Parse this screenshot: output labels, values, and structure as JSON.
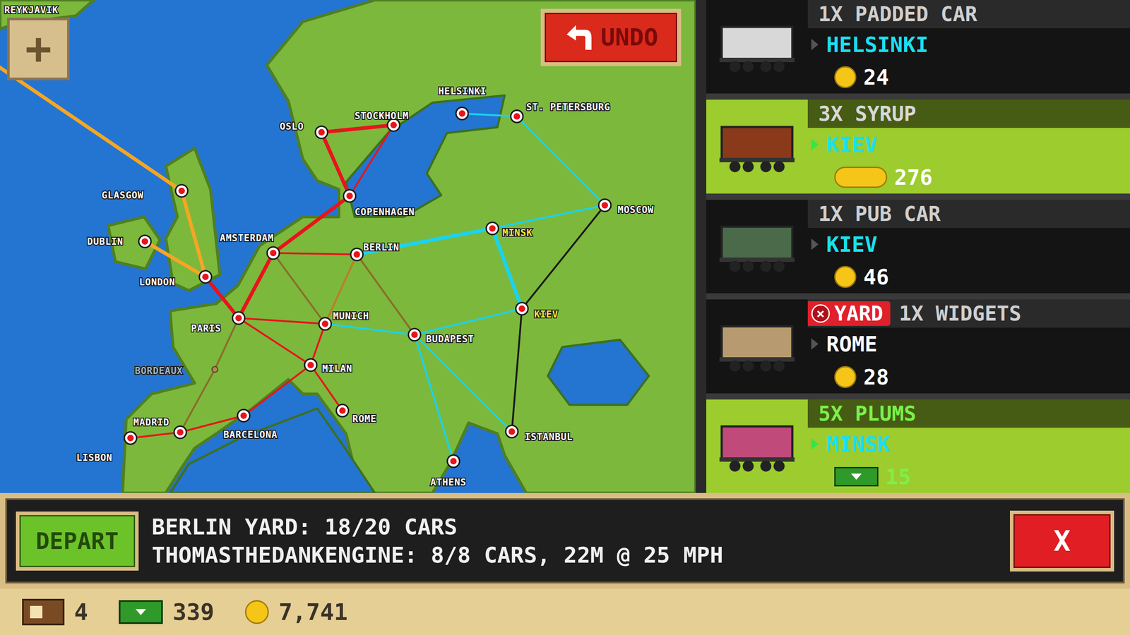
{
  "map": {
    "zoom_button": "+",
    "undo_button": "UNDO",
    "cities": [
      {
        "name": "REYKJAVIK",
        "state": "normal"
      },
      {
        "name": "GLASGOW",
        "state": "normal"
      },
      {
        "name": "DUBLIN",
        "state": "normal"
      },
      {
        "name": "LONDON",
        "state": "normal"
      },
      {
        "name": "PARIS",
        "state": "normal"
      },
      {
        "name": "BORDEAUX",
        "state": "inactive"
      },
      {
        "name": "MADRID",
        "state": "normal"
      },
      {
        "name": "LISBON",
        "state": "normal"
      },
      {
        "name": "BARCELONA",
        "state": "normal"
      },
      {
        "name": "MILAN",
        "state": "normal"
      },
      {
        "name": "ROME",
        "state": "normal"
      },
      {
        "name": "MUNICH",
        "state": "normal"
      },
      {
        "name": "AMSTERDAM",
        "state": "normal"
      },
      {
        "name": "BERLIN",
        "state": "normal"
      },
      {
        "name": "COPENHAGEN",
        "state": "normal"
      },
      {
        "name": "OSLO",
        "state": "normal"
      },
      {
        "name": "STOCKHOLM",
        "state": "normal"
      },
      {
        "name": "HELSINKI",
        "state": "normal"
      },
      {
        "name": "ST. PETERSBURG",
        "state": "normal"
      },
      {
        "name": "MOSCOW",
        "state": "normal"
      },
      {
        "name": "MINSK",
        "state": "highlighted"
      },
      {
        "name": "KIEV",
        "state": "highlighted"
      },
      {
        "name": "BUDAPEST",
        "state": "normal"
      },
      {
        "name": "ISTANBUL",
        "state": "normal"
      },
      {
        "name": "ATHENS",
        "state": "normal"
      }
    ],
    "routes": [
      {
        "from": 0,
        "to": 1,
        "color": "#f5a623",
        "kind": "thick"
      },
      {
        "from": 1,
        "to": 3,
        "color": "#f5a623",
        "kind": "thick"
      },
      {
        "from": 3,
        "to": 2,
        "color": "#f5a623",
        "kind": "thick"
      },
      {
        "from": 3,
        "to": 4,
        "color": "#e8141c",
        "kind": "thick"
      },
      {
        "from": 4,
        "to": 12,
        "color": "#e8141c",
        "kind": "thick"
      },
      {
        "from": 12,
        "to": 14,
        "color": "#e8141c",
        "kind": "thick"
      },
      {
        "from": 14,
        "to": 15,
        "color": "#e8141c",
        "kind": "thick"
      },
      {
        "from": 15,
        "to": 16,
        "color": "#e8141c",
        "kind": "thick"
      },
      {
        "from": 14,
        "to": 16,
        "color": "#e8141c",
        "kind": "thin"
      },
      {
        "from": 12,
        "to": 13,
        "color": "#e8141c",
        "kind": "thin"
      },
      {
        "from": 4,
        "to": 11,
        "color": "#e8141c",
        "kind": "thin"
      },
      {
        "from": 4,
        "to": 9,
        "color": "#e8141c",
        "kind": "thin"
      },
      {
        "from": 11,
        "to": 9,
        "color": "#e8141c",
        "kind": "thin"
      },
      {
        "from": 9,
        "to": 10,
        "color": "#e8141c",
        "kind": "thin"
      },
      {
        "from": 9,
        "to": 8,
        "color": "#e8141c",
        "kind": "thin"
      },
      {
        "from": 8,
        "to": 6,
        "color": "#e8141c",
        "kind": "thin"
      },
      {
        "from": 6,
        "to": 7,
        "color": "#e8141c",
        "kind": "thin"
      },
      {
        "from": 13,
        "to": 20,
        "color": "#19d3f0",
        "kind": "thick"
      },
      {
        "from": 20,
        "to": 21,
        "color": "#19d3f0",
        "kind": "thick"
      },
      {
        "from": 11,
        "to": 22,
        "color": "#19d3f0",
        "kind": "thin"
      },
      {
        "from": 22,
        "to": 21,
        "color": "#19d3f0",
        "kind": "thin"
      },
      {
        "from": 22,
        "to": 24,
        "color": "#19d3f0",
        "kind": "thin"
      },
      {
        "from": 22,
        "to": 23,
        "color": "#19d3f0",
        "kind": "thin"
      },
      {
        "from": 17,
        "to": 18,
        "color": "#19d3f0",
        "kind": "thin"
      },
      {
        "from": 18,
        "to": 19,
        "color": "#19d3f0",
        "kind": "thin"
      },
      {
        "from": 20,
        "to": 19,
        "color": "#19d3f0",
        "kind": "thin"
      },
      {
        "from": 19,
        "to": 21,
        "color": "#1a1a1a",
        "kind": "thin"
      },
      {
        "from": 21,
        "to": 23,
        "color": "#1a1a1a",
        "kind": "thin"
      },
      {
        "from": 4,
        "to": 5,
        "color": "#8a6d2a",
        "kind": "thin"
      },
      {
        "from": 5,
        "to": 6,
        "color": "#8a6d2a",
        "kind": "thin"
      },
      {
        "from": 12,
        "to": 11,
        "color": "#8a6d2a",
        "kind": "thin"
      },
      {
        "from": 13,
        "to": 11,
        "color": "#c07a2a",
        "kind": "thin"
      },
      {
        "from": 13,
        "to": 22,
        "color": "#8a6d2a",
        "kind": "thin"
      }
    ]
  },
  "cars": [
    {
      "title": "1X PADDED CAR",
      "title_color": "#cfcfcf",
      "destination": "HELSINKI",
      "destination_color": "#19e0f0",
      "reward": "24",
      "reward_kind": "coin",
      "reward_color": "#ffffff",
      "selected": false,
      "color": "#d8d8d8",
      "badge": null
    },
    {
      "title": "3X SYRUP",
      "title_color": "#d8d8d8",
      "destination": "KIEV",
      "destination_color": "#19e0f0",
      "reward": "276",
      "reward_kind": "coin-stack",
      "reward_color": "#ffffff",
      "selected": true,
      "color": "#8a3a1a",
      "badge": null
    },
    {
      "title": "1X PUB CAR",
      "title_color": "#cfcfcf",
      "destination": "KIEV",
      "destination_color": "#19e0f0",
      "reward": "46",
      "reward_kind": "coin",
      "reward_color": "#ffffff",
      "selected": false,
      "color": "#4a6a4a",
      "badge": null
    },
    {
      "title": "1X WIDGETS",
      "title_color": "#cfcfcf",
      "destination": "ROME",
      "destination_color": "#ffffff",
      "reward": "28",
      "reward_kind": "coin",
      "reward_color": "#ffffff",
      "selected": false,
      "color": "#b89a70",
      "badge": {
        "icon": "×",
        "label": "YARD"
      }
    },
    {
      "title": "5X PLUMS",
      "title_color": "#7cf04a",
      "destination": "MINSK",
      "destination_color": "#19e0f0",
      "reward": "15",
      "reward_kind": "cash",
      "reward_color": "#7cf04a",
      "selected": true,
      "color": "#c04a7a",
      "badge": null
    }
  ],
  "footer": {
    "depart_button": "DEPART",
    "yard_line": "BERLIN YARD: 18/20 CARS",
    "train_line": "THOMASTHEDANKENGINE: 8/8 CARS, 22M @ 25 MPH",
    "close_button": "X"
  },
  "status_bar": [
    {
      "kind": "crate",
      "value": "4"
    },
    {
      "kind": "cash",
      "value": "339"
    },
    {
      "kind": "coin",
      "value": "7,741"
    }
  ]
}
